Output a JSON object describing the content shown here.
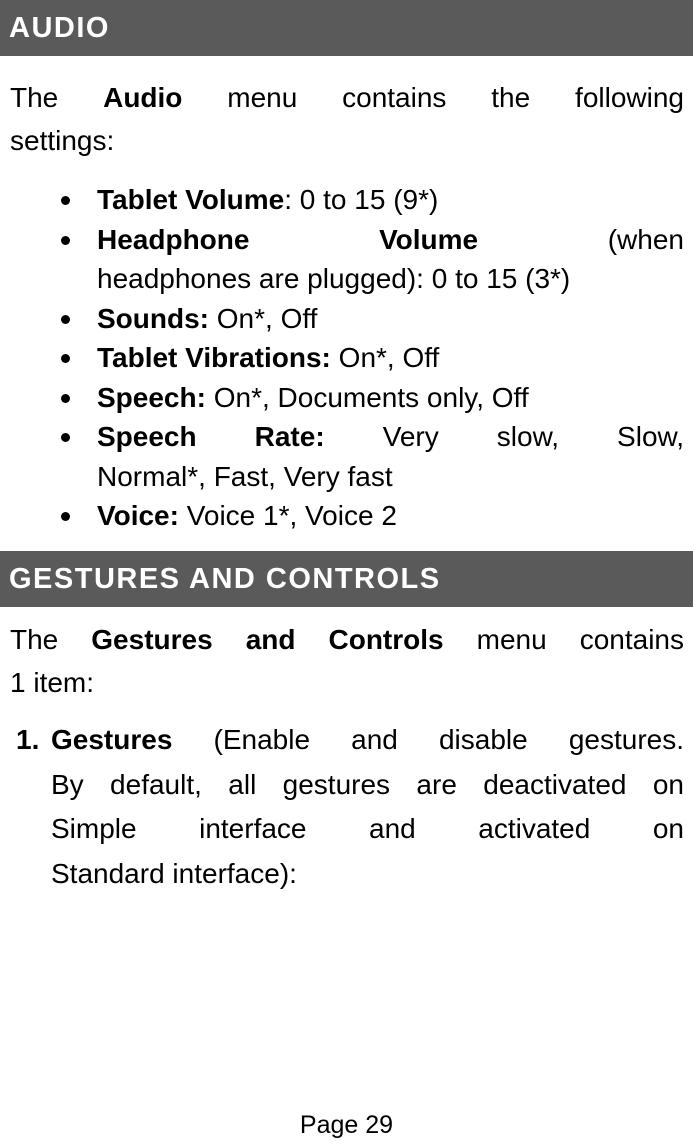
{
  "sections": {
    "audio": {
      "heading": "AUDIO",
      "intro": {
        "pre": "The ",
        "bold": "Audio",
        "post": " menu contains the following",
        "line2": "settings:"
      },
      "items": [
        {
          "label": "Tablet Volume",
          "sep": ": ",
          "value": "0 to 15 (9*)"
        },
        {
          "label": "Headphone Volume",
          "sep": " ",
          "value_line1": "(when",
          "value_line2": "headphones are plugged): 0 to 15 (3*)"
        },
        {
          "label": "Sounds:",
          "sep": " ",
          "value": "On*, Off"
        },
        {
          "label": "Tablet Vibrations:",
          "sep": " ",
          "value": "On*, Off"
        },
        {
          "label": "Speech:",
          "sep": " ",
          "value": "On*, Documents only, Off"
        },
        {
          "label": "Speech Rate:",
          "sep": " ",
          "value_line1": "Very slow, Slow,",
          "value_line2": "Normal*, Fast, Very fast"
        },
        {
          "label": "Voice:",
          "sep": " ",
          "value": "Voice 1*, Voice 2"
        }
      ]
    },
    "gestures": {
      "heading": "GESTURES AND CONTROLS",
      "intro": {
        "pre": "The ",
        "bold": "Gestures and Controls",
        "post": " menu contains",
        "line2": "1 item:"
      },
      "items": [
        {
          "number": "1.",
          "label": "Gestures",
          "line1": " (Enable and disable gestures.",
          "line2": "By default, all gestures are deactivated on",
          "line3": "Simple interface and activated on",
          "line4": "Standard interface):"
        }
      ]
    }
  },
  "footer": {
    "page_label": "Page 29"
  }
}
